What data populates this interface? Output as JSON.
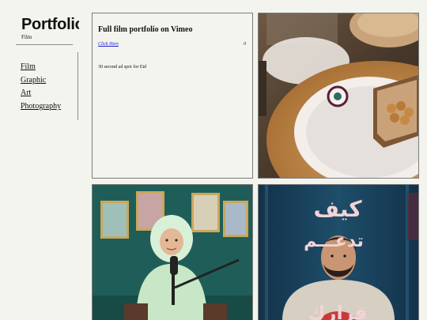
{
  "sidebar": {
    "title": "Portfolio",
    "subtitle": "Film",
    "nav": [
      {
        "label": "Film"
      },
      {
        "label": "Graphic"
      },
      {
        "label": "Art"
      },
      {
        "label": "Photography"
      }
    ]
  },
  "tiles": {
    "text_tile": {
      "heading": "Full film portfolio on Vimeo",
      "link": "Click Here",
      "count": "0",
      "description": "30 second ad spot for Eid"
    },
    "poster": {
      "arabic_title_line1": "كيف",
      "arabic_title_line2": "تدعـــم",
      "arabic_title_line3": "قرارك"
    }
  },
  "colors": {
    "page_bg": "#f4f4ee",
    "link": "#1a1ad6",
    "studio_wall": "#1f5e58",
    "poster_bg": "#1b3c55",
    "poster_text": "#f3d3d6"
  }
}
